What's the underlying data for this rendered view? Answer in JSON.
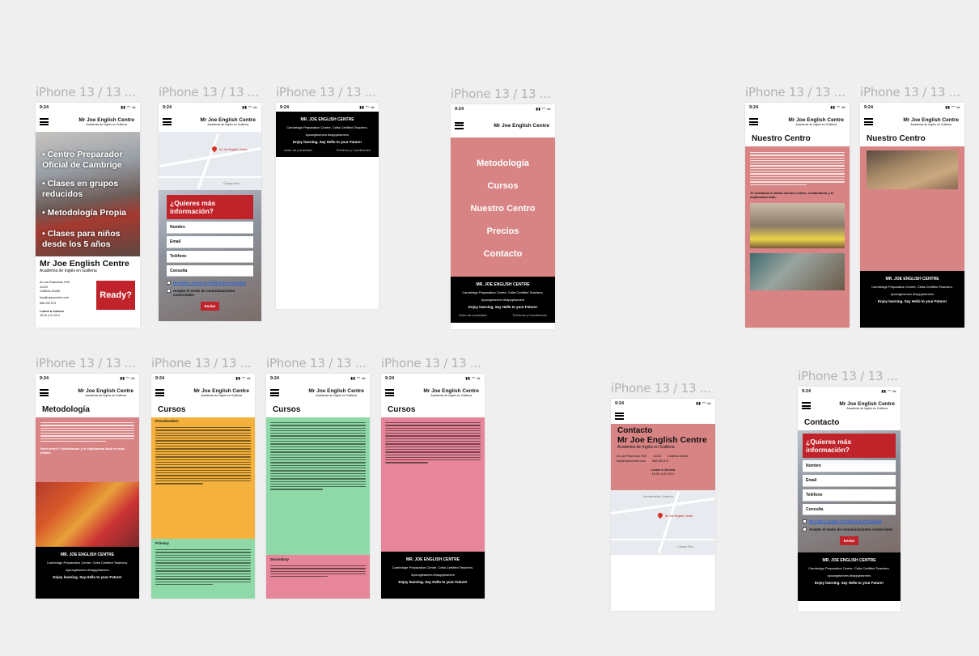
{
  "frame_label": "iPhone 13 / 13 ...",
  "status": {
    "time": "9:24",
    "icons": "▮▮ ◠ ▭"
  },
  "brand": {
    "title": "Mr Joe English Centre",
    "subtitle": "Academia de Inglés en Guillena"
  },
  "home": {
    "bullets": [
      "Centro Preparador Oficial de Cambrige",
      "Clases en grupos reducidos",
      "Metodología Propia",
      "Clases para niños desde los 5 años"
    ],
    "title": "Mr Joe English Centre",
    "subtitle": "Academia de Inglés en Guillena",
    "address": [
      "Av Las Palanosas nº49",
      "41210",
      "Guillena-Sevilla",
      "hey@mrjoecentre.com",
      "666 200 873"
    ],
    "hours_title": "Lunes a Jueves",
    "hours": "16.00 a 21.00 h",
    "ready": "Ready?"
  },
  "form": {
    "heading": "¿Quieres más información?",
    "fields": [
      "Nombre",
      "Email",
      "Teléfono",
      "Consulta"
    ],
    "privacy": "He leído y acepto la Política de Privacidad",
    "comms": "Acepto el envío de comunicaciones comerciales",
    "send": "Enviar"
  },
  "map": {
    "label": "Mr Joe English Centre",
    "street": "Hermandades Gutiérrez",
    "label2": "Colegio Pilar"
  },
  "footer": {
    "name": "MR. JOE ENGLISH CENTRE",
    "desc": "Cambridge Preparation Centre. Celta Certified Teachers.",
    "tags": "#youngteamers #happylearners",
    "slogan": "Enjoy learning. Say Hello to your Future!",
    "privacy": "Aviso de privacidad",
    "terms": "Términos y Condiciones"
  },
  "menu": [
    "Metodología",
    "Cursos",
    "Nuestro Centro",
    "Precios",
    "Contacto"
  ],
  "centro": {
    "title": "Nuestro Centro",
    "cta": "Te invitamos a visitar nuestro centro, contáctanos y te explicamos todo."
  },
  "metodologia": {
    "title": "Metodología",
    "cta": "Need more? Contáctanos y te explicamos todo en más detalle."
  },
  "cursos": {
    "title": "Cursos",
    "preschool": "Preschoolers",
    "primary": "Primary",
    "secondary": "Secondary"
  },
  "contacto": {
    "title": "Contacto"
  },
  "colors": {
    "pink": "#d88484",
    "orange": "#f4b13d",
    "green": "#8ed9a7",
    "rose": "#e7869a",
    "red": "#c0242a",
    "canvas": "#efefef"
  }
}
